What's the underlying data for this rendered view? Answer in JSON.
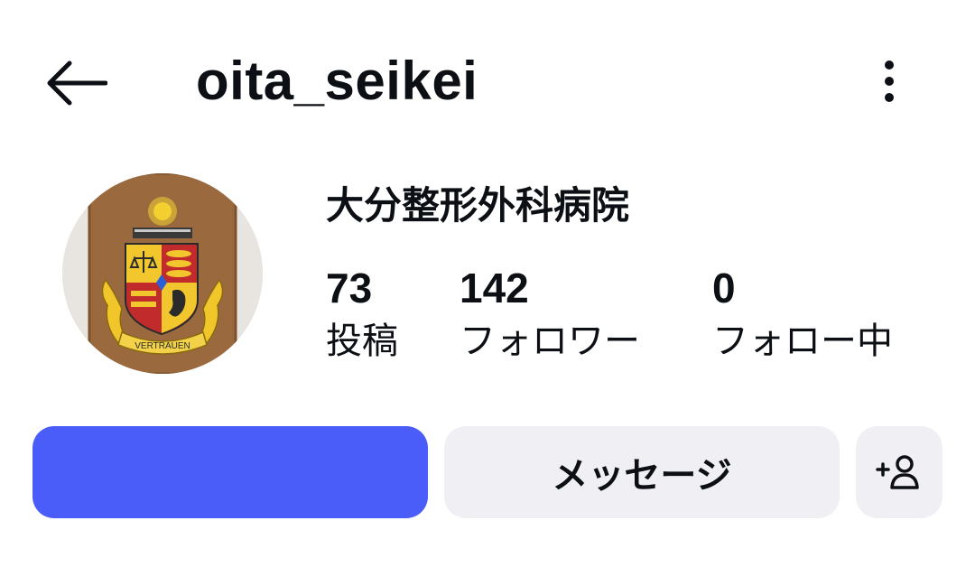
{
  "header": {
    "back_icon": "arrow-left-icon",
    "username": "oita_seikei",
    "more_icon": "more-vertical-icon"
  },
  "profile": {
    "avatar_icon": "coat-of-arms-avatar",
    "avatar_motto": "VERTRAUEN",
    "display_name": "大分整形外科病院",
    "stats": {
      "posts": {
        "value": "73",
        "label": "投稿"
      },
      "followers": {
        "value": "142",
        "label": "フォロワー"
      },
      "following": {
        "value": "0",
        "label": "フォロー中"
      }
    }
  },
  "actions": {
    "follow_label": "",
    "follow_color": "#4a5df9",
    "message_label": "メッセージ",
    "add_user_icon": "add-person-icon",
    "secondary_bg": "#efeff4"
  }
}
